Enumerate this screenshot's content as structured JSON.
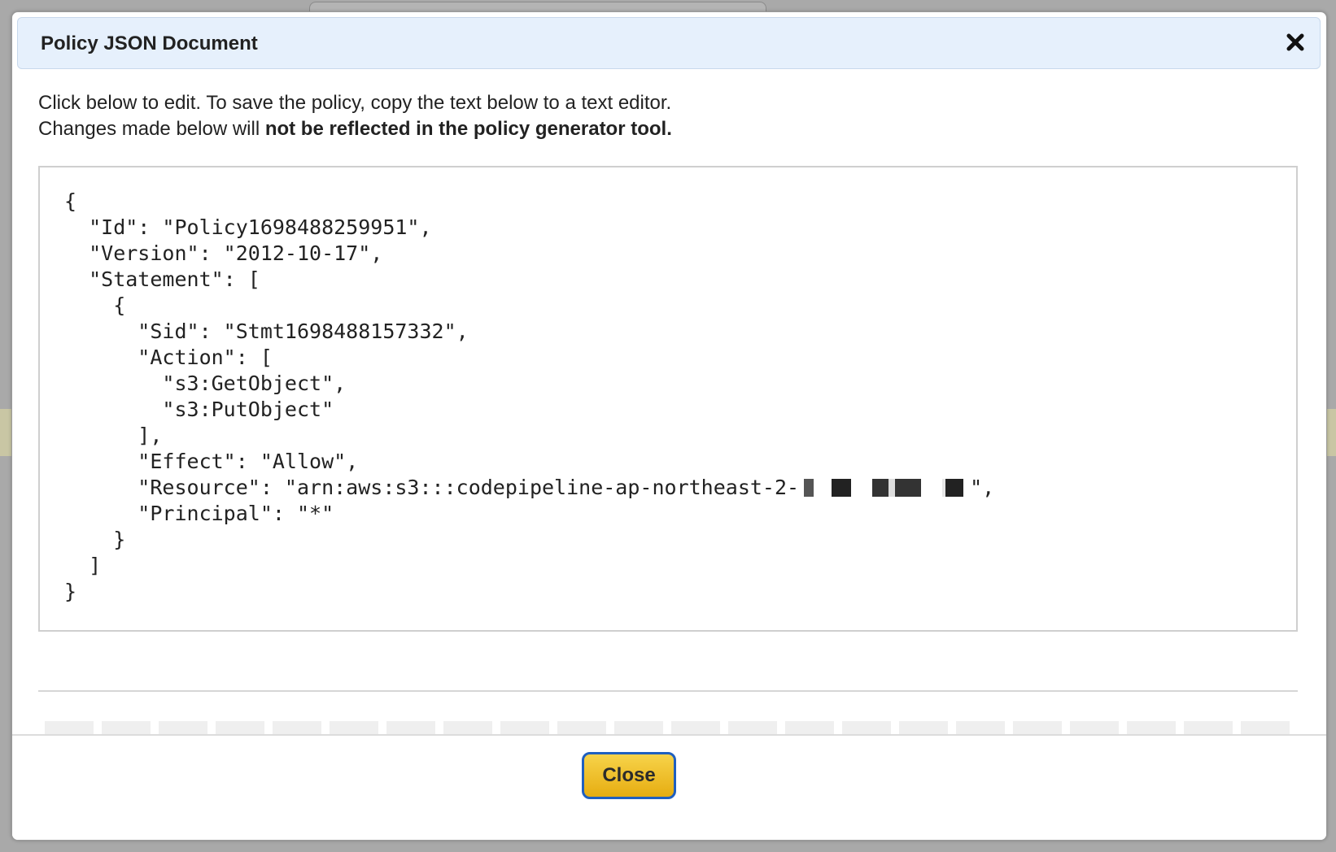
{
  "dialog": {
    "title": "Policy JSON Document",
    "instructions_line1": "Click below to edit. To save the policy, copy the text below to a text editor.",
    "instructions_line2_prefix": "Changes made below will ",
    "instructions_line2_bold": "not be reflected in the policy generator tool.",
    "json_lines": {
      "l1": "{",
      "l2": "  \"Id\": \"Policy1698488259951\",",
      "l3": "  \"Version\": \"2012-10-17\",",
      "l4": "  \"Statement\": [",
      "l5": "    {",
      "l6": "      \"Sid\": \"Stmt1698488157332\",",
      "l7": "      \"Action\": [",
      "l8": "        \"s3:GetObject\",",
      "l9": "        \"s3:PutObject\"",
      "l10": "      ],",
      "l11": "      \"Effect\": \"Allow\",",
      "l12_prefix": "      \"Resource\": \"arn:aws:s3:::codepipeline-ap-northeast-2-",
      "l12_suffix": "\",",
      "l13": "      \"Principal\": \"*\"",
      "l14": "    }",
      "l15": "  ]",
      "l16": "}"
    },
    "close_button_label": "Close"
  },
  "icons": {
    "close": "close-x-icon"
  },
  "colors": {
    "titlebar_bg": "#e6f0fc",
    "button_bg": "#f0c22e",
    "button_border": "#1f5fbf",
    "overlay": "#a9a9a9"
  }
}
